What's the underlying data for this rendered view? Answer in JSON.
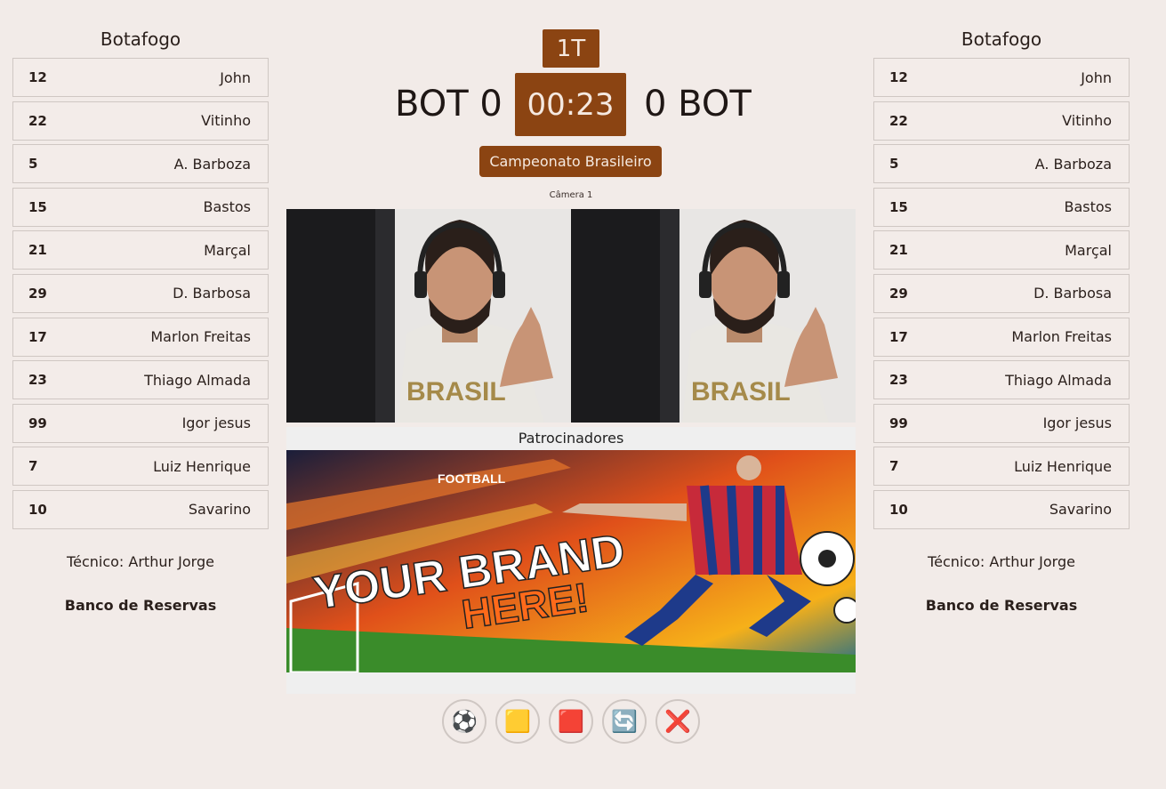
{
  "left_team": {
    "name": "Botafogo",
    "players": [
      {
        "number": "12",
        "name": "John"
      },
      {
        "number": "22",
        "name": "Vitinho"
      },
      {
        "number": "5",
        "name": "A. Barboza"
      },
      {
        "number": "15",
        "name": "Bastos"
      },
      {
        "number": "21",
        "name": "Marçal"
      },
      {
        "number": "29",
        "name": "D. Barbosa"
      },
      {
        "number": "17",
        "name": "Marlon Freitas"
      },
      {
        "number": "23",
        "name": "Thiago Almada"
      },
      {
        "number": "99",
        "name": "Igor jesus"
      },
      {
        "number": "7",
        "name": "Luiz Henrique"
      },
      {
        "number": "10",
        "name": "Savarino"
      }
    ],
    "coach": "Técnico: Arthur Jorge",
    "bench": "Banco de Reservas"
  },
  "right_team": {
    "name": "Botafogo",
    "players": [
      {
        "number": "12",
        "name": "John"
      },
      {
        "number": "22",
        "name": "Vitinho"
      },
      {
        "number": "5",
        "name": "A. Barboza"
      },
      {
        "number": "15",
        "name": "Bastos"
      },
      {
        "number": "21",
        "name": "Marçal"
      },
      {
        "number": "29",
        "name": "D. Barbosa"
      },
      {
        "number": "17",
        "name": "Marlon Freitas"
      },
      {
        "number": "23",
        "name": "Thiago Almada"
      },
      {
        "number": "99",
        "name": "Igor jesus"
      },
      {
        "number": "7",
        "name": "Luiz Henrique"
      },
      {
        "number": "10",
        "name": "Savarino"
      }
    ],
    "coach": "Técnico: Arthur Jorge",
    "bench": "Banco de Reservas"
  },
  "scoreboard": {
    "period": "1T",
    "home": "BOT 0",
    "clock": "00:23",
    "away": "0 BOT",
    "competition": "Campeonato Brasileiro"
  },
  "camera": {
    "label": "Câmera 1"
  },
  "sponsors": {
    "title": "Patrocinadores",
    "banner_small_text": "FOOTBALL",
    "banner_line1": "YOUR BRAND",
    "banner_line2": "HERE!"
  },
  "controls": [
    {
      "name": "goal-button",
      "icon": "⚽"
    },
    {
      "name": "yellow-card-button",
      "icon": "🟨"
    },
    {
      "name": "red-card-button",
      "icon": "🟥"
    },
    {
      "name": "substitution-button",
      "icon": "🔄"
    },
    {
      "name": "cancel-button",
      "icon": "❌"
    }
  ],
  "colors": {
    "accent": "#8b4412",
    "background": "#f2ebe8",
    "accent_text": "#f5e9e0"
  }
}
